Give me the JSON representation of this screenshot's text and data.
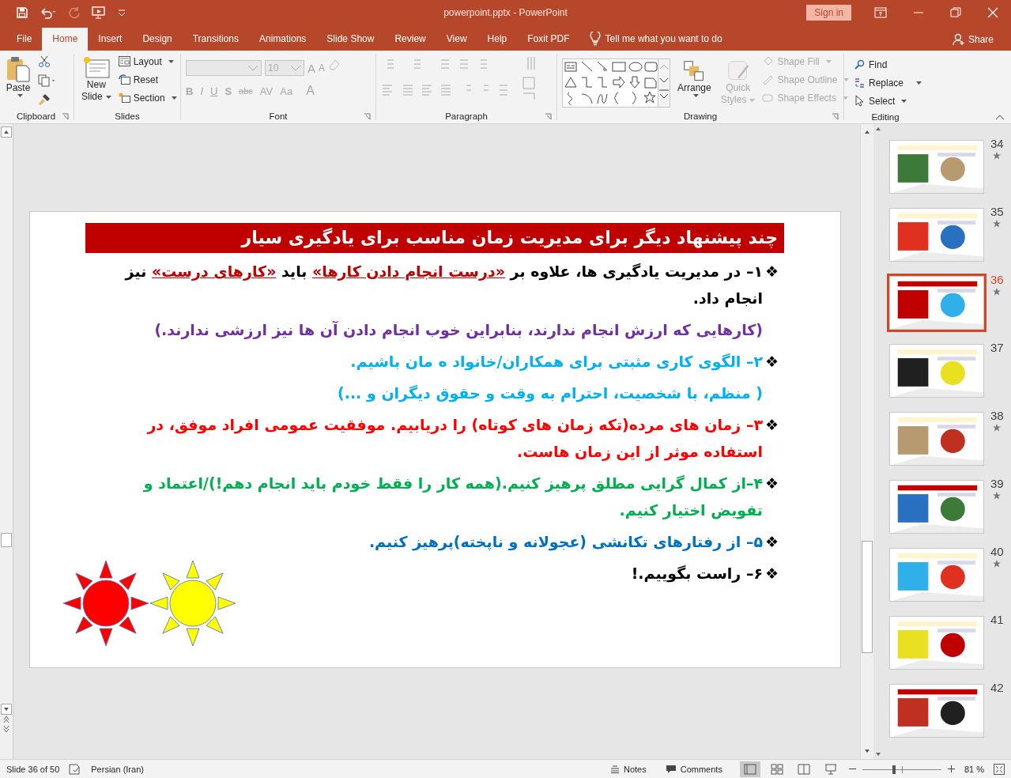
{
  "title_bar": {
    "document": "powerpoint.pptx  -  PowerPoint",
    "sign_in": "Sign in"
  },
  "tabs": [
    {
      "label": "File",
      "selected": false
    },
    {
      "label": "Home",
      "selected": true
    },
    {
      "label": "Insert",
      "selected": false
    },
    {
      "label": "Design",
      "selected": false
    },
    {
      "label": "Transitions",
      "selected": false
    },
    {
      "label": "Animations",
      "selected": false
    },
    {
      "label": "Slide Show",
      "selected": false
    },
    {
      "label": "Review",
      "selected": false
    },
    {
      "label": "View",
      "selected": false
    },
    {
      "label": "Help",
      "selected": false
    },
    {
      "label": "Foxit PDF",
      "selected": false
    }
  ],
  "tell_me": "Tell me what you want to do",
  "share": "Share",
  "ribbon": {
    "clipboard": {
      "label": "Clipboard",
      "paste": "Paste"
    },
    "slides": {
      "label": "Slides",
      "new_slide": [
        "New",
        "Slide"
      ],
      "layout": "Layout",
      "reset": "Reset",
      "section": "Section"
    },
    "font": {
      "label": "Font",
      "size": "10",
      "grow": "A",
      "shrink": "A",
      "buttons": [
        "B",
        "I",
        "U",
        "S",
        "abc",
        "AV",
        "Aa",
        "A"
      ]
    },
    "paragraph": {
      "label": "Paragraph"
    },
    "drawing": {
      "label": "Drawing",
      "arrange": "Arrange",
      "quick_styles": [
        "Quick",
        "Styles"
      ],
      "shape_fill": "Shape Fill",
      "shape_outline": "Shape Outline",
      "shape_effects": "Shape Effects"
    },
    "editing": {
      "label": "Editing",
      "find": "Find",
      "replace": "Replace",
      "select": "Select"
    }
  },
  "slide": {
    "title": "چند پیشنهاد دیگر برای مدیریت زمان مناسب برای یادگیری سیار",
    "paragraphs": [
      {
        "bullet": "❖",
        "color": "#000000",
        "segments": [
          {
            "text": "۱– در مدیریت یادگیری ها، علاوه بر ",
            "emphasis": false
          },
          {
            "text": "«درست انجام دادن کارها»",
            "emphasis": true
          },
          {
            "text": " باید ",
            "emphasis": false
          },
          {
            "text": "«کارهای درست»",
            "emphasis": true
          },
          {
            "text": " نیز انجام داد.",
            "emphasis": false
          }
        ]
      },
      {
        "color": "#7030a0",
        "segments": [
          {
            "text": "(کارهایی که ارزش انجام ندارند، بنابراین خوب انجام دادن آن ها نیز ارزشی ندارند.)",
            "emphasis": false
          }
        ]
      },
      {
        "bullet": "❖",
        "color": "#00b0f0",
        "segments": [
          {
            "text": "۲– الگوی کاری مثبتی برای همکاران/خانواد ه مان باشیم.",
            "emphasis": false
          }
        ]
      },
      {
        "color": "#00b0f0",
        "segments": [
          {
            "text": "( منظم، با شخصیت، احترام به وقت و حقوق دیگران و ...)",
            "emphasis": false
          }
        ]
      },
      {
        "bullet": "❖",
        "color": "#ff0000",
        "segments": [
          {
            "text": "۳– زمان های مرده(تکه زمان های کوتاه) را دریابیم. موفقیت عمومی افراد موفق، در استفاده موثر از این زمان هاست.",
            "emphasis": false
          }
        ]
      },
      {
        "bullet": "❖",
        "color": "#00b050",
        "segments": [
          {
            "text": "۴–از کمال گرایی مطلق پرهیز کنیم.(همه کار را فقط خودم باید انجام دهم!)/اعتماد و تفویض اختیار کنیم.",
            "emphasis": false
          }
        ]
      },
      {
        "bullet": "❖",
        "color": "#0070c0",
        "segments": [
          {
            "text": "۵– از رفتارهای تکانشی (عجولانه و ناپخته)پرهیز کنیم.",
            "emphasis": false
          }
        ]
      },
      {
        "bullet": "❖",
        "color": "#000000",
        "segments": [
          {
            "text": "۶– راست بگوییم.!",
            "emphasis": false
          }
        ]
      }
    ]
  },
  "thumbnails": [
    {
      "number": "34",
      "animated": true,
      "selected": false
    },
    {
      "number": "35",
      "animated": true,
      "selected": false
    },
    {
      "number": "36",
      "animated": true,
      "selected": true
    },
    {
      "number": "37",
      "animated": false,
      "selected": false
    },
    {
      "number": "38",
      "animated": true,
      "selected": false
    },
    {
      "number": "39",
      "animated": true,
      "selected": false
    },
    {
      "number": "40",
      "animated": true,
      "selected": false
    },
    {
      "number": "41",
      "animated": false,
      "selected": false
    },
    {
      "number": "42",
      "animated": false,
      "selected": false
    }
  ],
  "status_bar": {
    "slide": "Slide 36 of 50",
    "language": "Persian (Iran)",
    "notes": "Notes",
    "comments": "Comments",
    "zoom": {
      "level": 0.4
    },
    "zoom_reading": "81 %"
  }
}
